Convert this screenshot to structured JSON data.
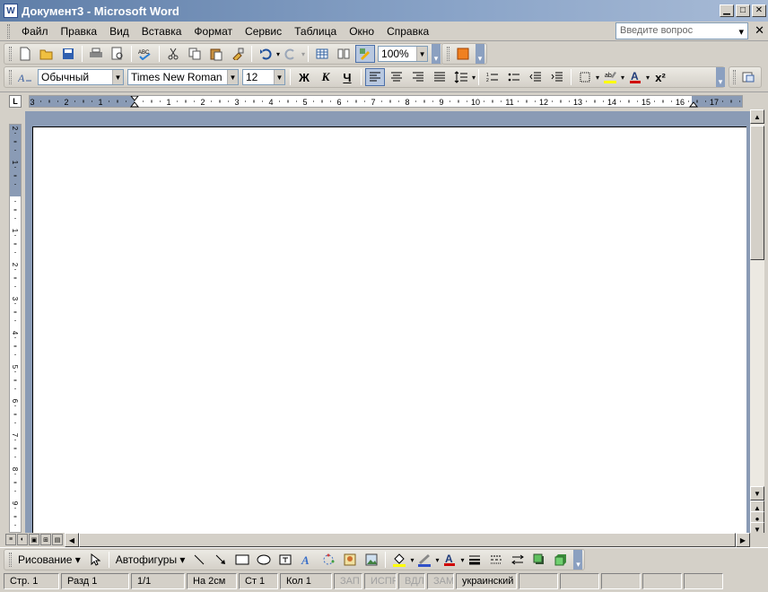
{
  "window": {
    "title": "Документ3 - Microsoft Word",
    "app_icon": "W",
    "minimize_glyph": "▁",
    "maximize_glyph": "□",
    "close_glyph": "✕"
  },
  "menu": {
    "items": [
      "Файл",
      "Правка",
      "Вид",
      "Вставка",
      "Формат",
      "Сервис",
      "Таблица",
      "Окно",
      "Справка"
    ],
    "help_placeholder": "Введите вопрос",
    "help_arrow": "▾",
    "doc_close": "✕"
  },
  "standard_toolbar": {
    "zoom": "100%",
    "icons": [
      "new-icon",
      "open-icon",
      "save-icon",
      "print-icon",
      "print-preview-icon",
      "spelling-icon",
      "cut-icon",
      "copy-icon",
      "paste-icon",
      "format-painter-icon",
      "undo-icon",
      "redo-icon",
      "insert-table-icon",
      "columns-icon",
      "drawing-icon",
      "zoom-combo",
      "research-icon"
    ]
  },
  "formatting_toolbar": {
    "style": "Обычный",
    "font": "Times New Roman",
    "size": "12",
    "bold": "Ж",
    "italic": "К",
    "underline": "Ч",
    "superscript": "x²"
  },
  "drawing_toolbar": {
    "draw_label": "Рисование",
    "autoshapes_label": "Автофигуры"
  },
  "ruler": {
    "tab_glyph": "L",
    "h_numbers": [
      "3",
      "2",
      "1",
      "1",
      "2",
      "3",
      "4",
      "5",
      "6",
      "7",
      "8",
      "9",
      "10",
      "11",
      "12",
      "13",
      "14",
      "15",
      "16",
      "17"
    ],
    "v_numbers": [
      "2",
      "1",
      "1",
      "2",
      "3",
      "4",
      "5",
      "6",
      "7",
      "8",
      "9"
    ]
  },
  "statusbar": {
    "page": "Стр. 1",
    "section": "Разд  1",
    "pages": "1/1",
    "at": "На  2см",
    "line": "Ст  1",
    "col": "Кол  1",
    "rec": "ЗАП",
    "trk": "ИСПР",
    "ext": "ВДЛ",
    "ovr": "ЗАМ",
    "language": "украинский"
  },
  "colors": {
    "titlebar": "#5f7ea8",
    "workspace": "#8a9bb5",
    "highlight_yellow": "#ffff00",
    "font_color_red": "#d00000"
  }
}
